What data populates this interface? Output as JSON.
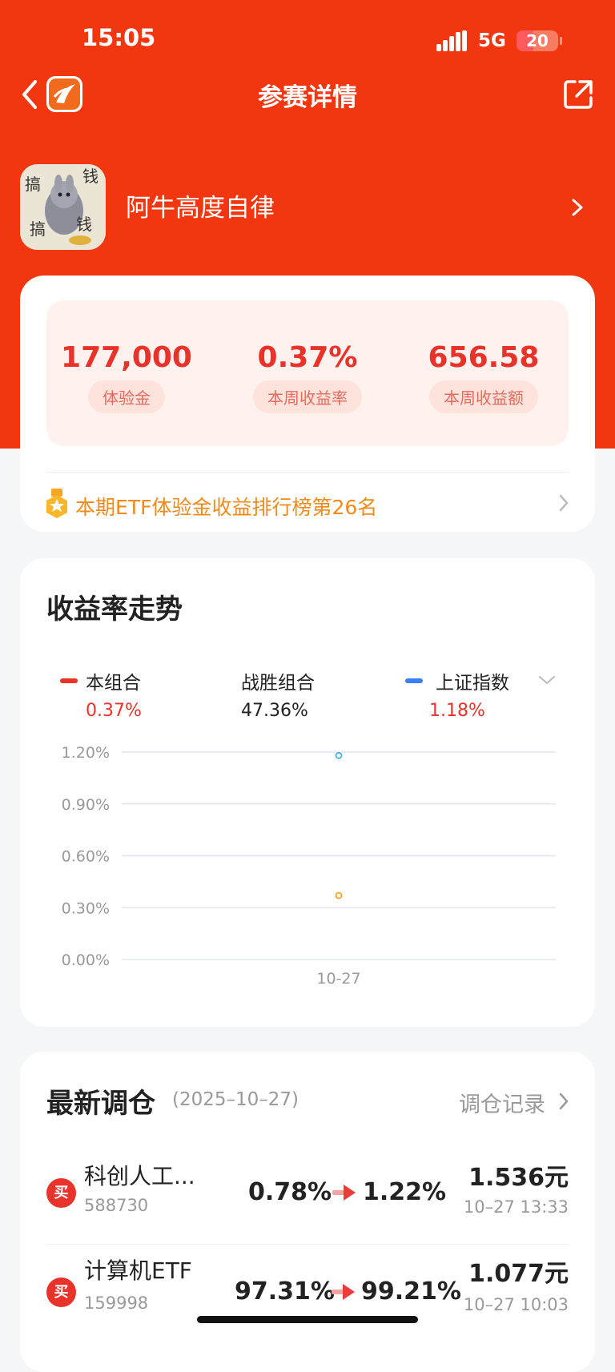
{
  "status_bar": {
    "time": "15:05",
    "network": "5G",
    "battery": "20"
  },
  "nav": {
    "title": "参赛详情"
  },
  "user": {
    "name": "阿牛高度自律"
  },
  "stats": [
    {
      "value": "177,000",
      "label": "体验金"
    },
    {
      "value": "0.37%",
      "label": "本周收益率"
    },
    {
      "value": "656.58",
      "label": "本周收益额"
    }
  ],
  "rank": {
    "text": "本期ETF体验金收益排行榜第26名"
  },
  "chart": {
    "title": "收益率走势",
    "legend": [
      {
        "name": "本组合",
        "value": "0.37%",
        "color": "#e8322a"
      },
      {
        "name": "战胜组合",
        "value": "47.36%",
        "color": "#222222"
      },
      {
        "name": "上证指数",
        "value": "1.18%",
        "color": "#3b7ef6"
      }
    ]
  },
  "chart_data": {
    "type": "scatter",
    "title": "收益率走势",
    "x": [
      "10-27"
    ],
    "y_ticks": [
      "1.20%",
      "0.90%",
      "0.60%",
      "0.30%",
      "0.00%"
    ],
    "ylim": [
      0,
      1.2
    ],
    "series": [
      {
        "name": "上证指数",
        "values": [
          1.18
        ],
        "color": "#4ab0e6"
      },
      {
        "name": "本组合",
        "values": [
          0.37
        ],
        "color": "#f5a623"
      }
    ],
    "grid": true
  },
  "rebalance": {
    "title": "最新调仓",
    "date": "(2025–10–27)",
    "link": "调仓记录",
    "rows": [
      {
        "badge": "买",
        "name": "科创人工...",
        "code": "588730",
        "from": "0.78%",
        "to": "1.22%",
        "price": "1.536元",
        "time": "10–27 13:33"
      },
      {
        "badge": "买",
        "name": "计算机ETF",
        "code": "159998",
        "from": "97.31%",
        "to": "99.21%",
        "price": "1.077元",
        "time": "10–27 10:03"
      }
    ]
  }
}
